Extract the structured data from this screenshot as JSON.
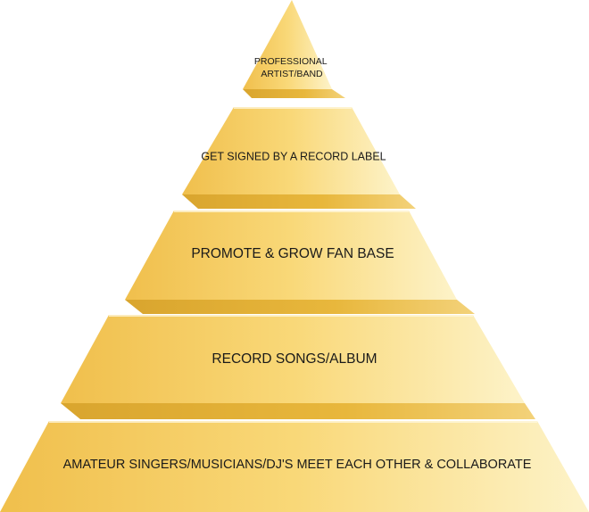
{
  "diagram": {
    "colors": {
      "face_light": "#fdf3c9",
      "face_mid": "#f9d878",
      "face_dark": "#f0bf4c",
      "shelf": "#e4b135",
      "shelf_shadow": "#c99a2a",
      "highlight": "#fff8e0",
      "text": "#1a1a1a"
    },
    "tiers": [
      {
        "label_line1": "PROFESSIONAL",
        "label_line2": "ARTIST/BAND"
      },
      {
        "label": "GET SIGNED BY A RECORD LABEL"
      },
      {
        "label": "PROMOTE & GROW FAN BASE"
      },
      {
        "label": "RECORD SONGS/ALBUM"
      },
      {
        "label": "AMATEUR SINGERS/MUSICIANS/DJ'S MEET EACH OTHER & COLLABORATE"
      }
    ]
  }
}
